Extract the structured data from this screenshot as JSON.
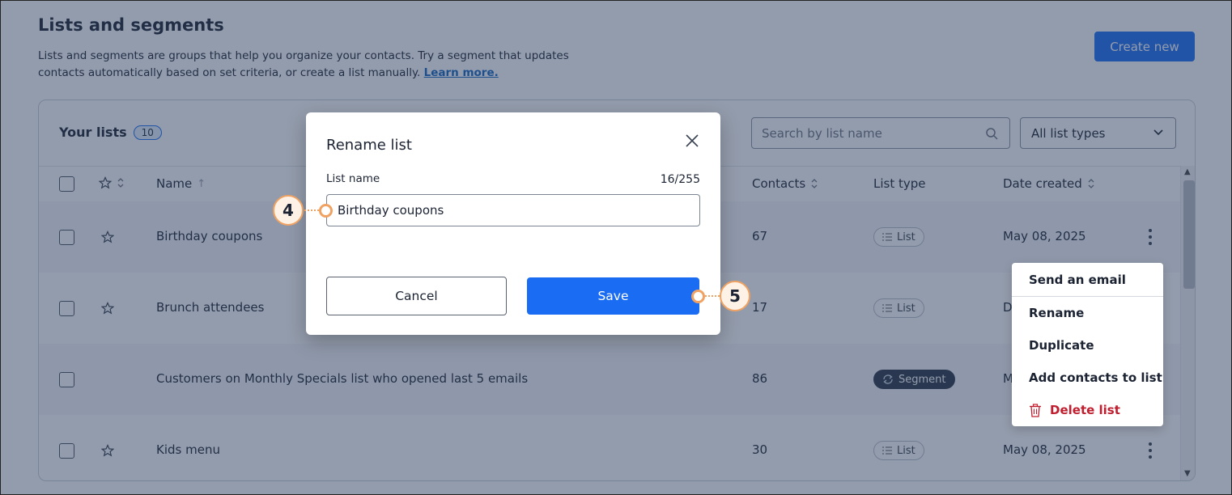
{
  "page": {
    "title": "Lists and segments",
    "description": "Lists and segments are groups that help you organize your contacts. Try a segment that updates contacts automatically based on set criteria, or create a list manually.",
    "learn_more": "Learn more.",
    "create_button": "Create new"
  },
  "card": {
    "title": "Your lists",
    "count": "10",
    "search_placeholder": "Search by list name",
    "type_filter": "All list types"
  },
  "table": {
    "columns": {
      "name": "Name",
      "contacts": "Contacts",
      "list_type": "List type",
      "date_created": "Date created"
    },
    "rows": [
      {
        "name": "Birthday coupons",
        "contacts": "67",
        "type": "List",
        "date": "May 08, 2025"
      },
      {
        "name": "Brunch attendees",
        "contacts": "17",
        "type": "List",
        "date": "D"
      },
      {
        "name": "Customers on Monthly Specials list who opened last 5 emails",
        "contacts": "86",
        "type": "Segment",
        "date": "M"
      },
      {
        "name": "Kids menu",
        "contacts": "30",
        "type": "List",
        "date": "May 08, 2025"
      }
    ]
  },
  "menu": {
    "items": [
      "Send an email",
      "Rename",
      "Duplicate",
      "Add contacts to list",
      "Delete list"
    ]
  },
  "modal": {
    "title": "Rename list",
    "field_label": "List name",
    "char_count": "16/255",
    "field_value": "Birthday coupons",
    "cancel": "Cancel",
    "save": "Save"
  },
  "callouts": {
    "step_4": "4",
    "step_5": "5"
  },
  "colors": {
    "primary": "#1a6cf3",
    "danger": "#c01d2e",
    "callout": "#f0a263"
  }
}
